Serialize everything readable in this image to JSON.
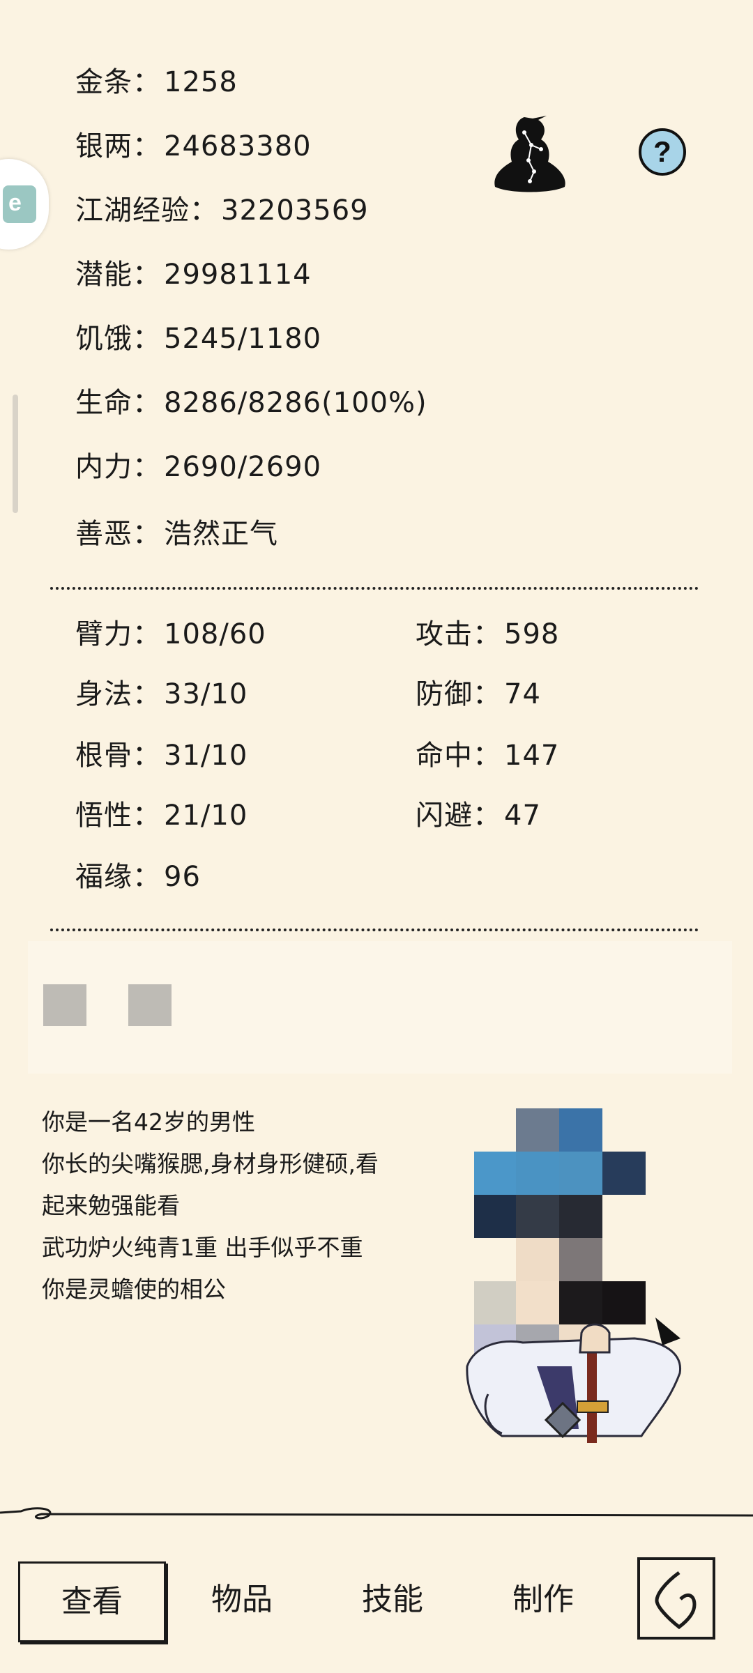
{
  "stats_top": [
    {
      "label": "金条：",
      "value": "1258"
    },
    {
      "label": "银两：",
      "value": "24683380"
    },
    {
      "label": "江湖经验：",
      "value": "32203569"
    },
    {
      "label": "潜能：",
      "value": "29981114"
    },
    {
      "label": "饥饿：",
      "value": "5245/1180"
    },
    {
      "label": "生命：",
      "value": "8286/8286(100%)"
    },
    {
      "label": "内力：",
      "value": "2690/2690"
    },
    {
      "label": "善恶：",
      "value": "浩然正气"
    }
  ],
  "attributes_left": [
    {
      "label": "臂力：",
      "value": "108/60"
    },
    {
      "label": "身法：",
      "value": "33/10"
    },
    {
      "label": "根骨：",
      "value": "31/10"
    },
    {
      "label": "悟性：",
      "value": "21/10"
    },
    {
      "label": "福缘：",
      "value": "96"
    }
  ],
  "attributes_right": [
    {
      "label": "攻击：",
      "value": "598"
    },
    {
      "label": "防御：",
      "value": "74"
    },
    {
      "label": "命中：",
      "value": "147"
    },
    {
      "label": "闪避：",
      "value": "47"
    }
  ],
  "description": [
    "你是一名42岁的男性",
    "你长的尖嘴猴腮,身材身形健硕,看",
    "起来勉强能看",
    "武功炉火纯青1重 出手似乎不重",
    "你是灵蟾使的相公"
  ],
  "tabs": [
    "查看",
    "物品",
    "技能",
    "制作"
  ],
  "icons": {
    "help": "question-mark-icon",
    "meditation": "meditation-icon",
    "back": "back-arrow-icon",
    "side": "side-badge-icon"
  },
  "colors": {
    "background": "#fbf3e2",
    "text": "#1a1a1a",
    "help_fill": "#a8d4e8"
  }
}
